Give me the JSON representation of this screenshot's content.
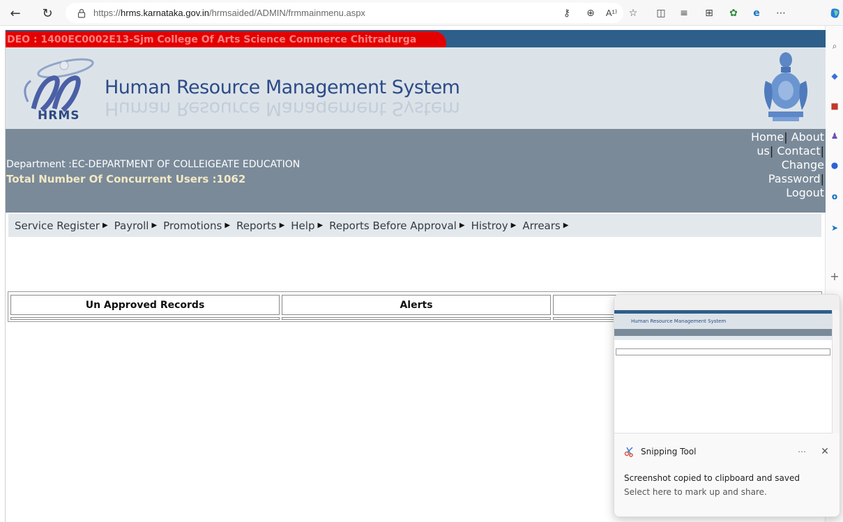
{
  "browser": {
    "url_prefix": "https://",
    "url_host": "hrms.karnataka.gov.in",
    "url_path": "/hrmsaided/ADMIN/frmmainmenu.aspx",
    "read_aloud_label": "A¹⁾"
  },
  "header": {
    "deo_text": "DEO : 1400EC0002E13-Sjm College Of Arts Science Commerce Chitradurga",
    "system_title": "Human Resource Management System",
    "logo_caption": "HRMS"
  },
  "info": {
    "department": "Department :EC-DEPARTMENT OF COLLEIGEATE EDUCATION",
    "concurrent_users": "Total Number Of Concurrent Users :1062"
  },
  "top_links": {
    "home": "Home",
    "about": "About us",
    "contact": "Contact",
    "change_password": "Change Password",
    "logout": "Logout"
  },
  "menu": [
    {
      "label": "Service Register"
    },
    {
      "label": "Payroll"
    },
    {
      "label": "Promotions"
    },
    {
      "label": "Reports"
    },
    {
      "label": "Help"
    },
    {
      "label": "Reports Before Approval"
    },
    {
      "label": "Histroy"
    },
    {
      "label": "Arrears"
    }
  ],
  "tabs": {
    "unapproved": "Un Approved Records",
    "alerts": "Alerts"
  },
  "toast": {
    "app_name": "Snipping Tool",
    "message": "Screenshot copied to clipboard and saved",
    "sub_message": "Select here to mark up and share.",
    "preview_title": "Human Resource Management System",
    "more_label": "⋯",
    "close_label": "✕"
  },
  "colors": {
    "deo_bar": "#2e5f8a",
    "deo_highlight": "#e30000",
    "banner": "#dce3e8",
    "info_bar": "#7a8a99",
    "menu_bar": "#e3e8ec",
    "title_blue": "#2c4b88"
  },
  "icons": {
    "back": "back-arrow-icon",
    "refresh": "refresh-icon",
    "lock": "lock-icon",
    "emblem": "karnataka-emblem-icon",
    "logo": "hrms-logo-icon"
  }
}
